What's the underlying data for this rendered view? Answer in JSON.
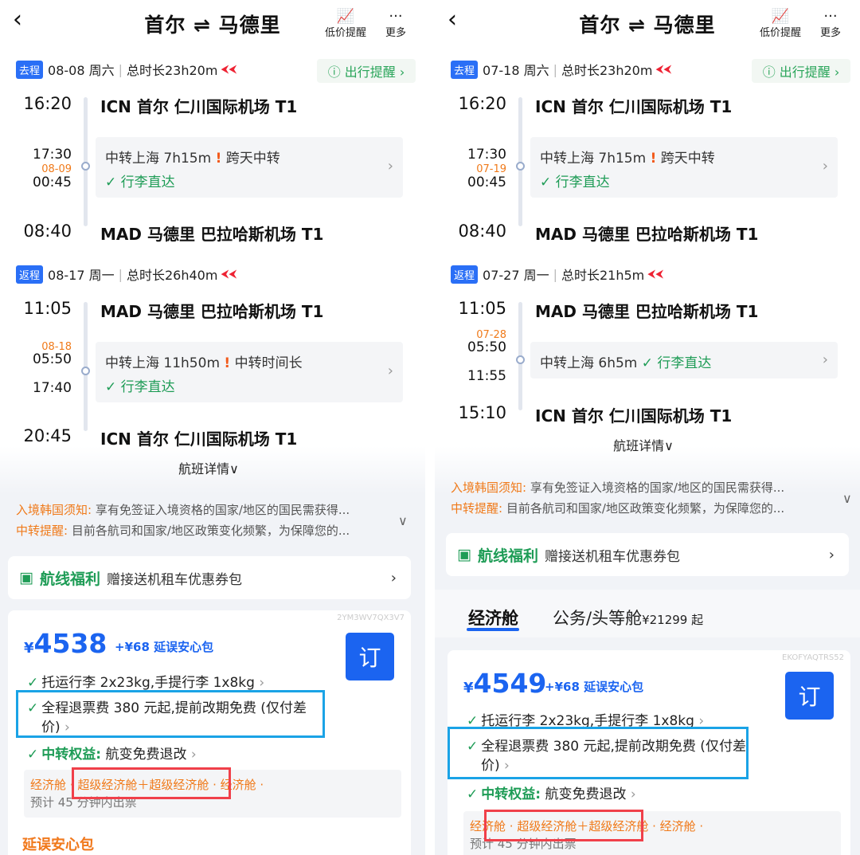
{
  "left": {
    "header": {
      "title": "首尔 ⇌ 马德里",
      "lowprice_label": "低价提醒",
      "more_label": "更多"
    },
    "outbound": {
      "tag": "去程",
      "date": "08-08 周六",
      "duration": "总时长23h20m",
      "remind": "ⓘ 出行提醒 ›",
      "dep_time": "16:20",
      "dep_airport": "ICN 首尔 仁川国际机场 T1",
      "t_arr": "17:30",
      "t_nextday": "08-09",
      "t_dep": "00:45",
      "transfer": "中转上海 7h15m",
      "warn_icon": "!",
      "warn_text": "跨天中转",
      "baggage": "✓ 行李直达",
      "arr_time": "08:40",
      "arr_airport": "MAD 马德里 巴拉哈斯机场 T1"
    },
    "return": {
      "tag": "返程",
      "date": "08-17 周一",
      "duration": "总时长26h40m",
      "dep_time": "11:05",
      "dep_airport": "MAD 马德里 巴拉哈斯机场 T1",
      "t_nextday": "08-18",
      "t_arr": "05:50",
      "t_dep": "17:40",
      "transfer": "中转上海 11h50m",
      "warn_icon": "!",
      "warn_text": "中转时间长",
      "baggage": "✓ 行李直达",
      "arr_time": "20:45",
      "arr_airport": "ICN 首尔 仁川国际机场 T1"
    },
    "detail": "航班详情∨",
    "notice1_label": "入境韩国须知:",
    "notice1_text": "享有免签证入境资格的国家/地区的国民需获得...",
    "notice2_label": "中转提醒:",
    "notice2_text": "目前各航司和国家/地区政策变化频繁，为保障您的...",
    "benefit_title": "航线福利",
    "benefit_text": "赠接送机租车优惠券包",
    "card": {
      "code": "2YM3WV7QX3V7",
      "currency": "¥",
      "price": "4538",
      "addon": "+¥68 延误安心包",
      "book": "订",
      "row1": "托运行李 2x23kg,手提行李 1x8kg",
      "row2a": "全程退票费 380 元起,提前改期免费 (仅付差",
      "row2b": "价)",
      "row3_label": "中转权益:",
      "row3_text": "航变免费退改",
      "cabin1": "经济舱 · ",
      "cabin2": "超级经济舱＋超级经济舱",
      "cabin3": " · 经济舱 ·",
      "cabin_note": "预计 45 分钟内出票",
      "promo": "延误安心包"
    }
  },
  "right": {
    "header": {
      "title": "首尔 ⇌ 马德里",
      "lowprice_label": "低价提醒",
      "more_label": "更多"
    },
    "outbound": {
      "tag": "去程",
      "date": "07-18 周六",
      "duration": "总时长23h20m",
      "remind": "ⓘ 出行提醒 ›",
      "dep_time": "16:20",
      "dep_airport": "ICN 首尔 仁川国际机场 T1",
      "t_arr": "17:30",
      "t_nextday": "07-19",
      "t_dep": "00:45",
      "transfer": "中转上海 7h15m",
      "warn_icon": "!",
      "warn_text": "跨天中转",
      "baggage": "✓ 行李直达",
      "arr_time": "08:40",
      "arr_airport": "MAD 马德里 巴拉哈斯机场 T1"
    },
    "return": {
      "tag": "返程",
      "date": "07-27 周一",
      "duration": "总时长21h5m",
      "dep_time": "11:05",
      "dep_airport": "MAD 马德里 巴拉哈斯机场 T1",
      "t_nextday": "07-28",
      "t_arr": "05:50",
      "t_dep": "11:55",
      "transfer": "中转上海 6h5m",
      "baggage": "✓ 行李直达",
      "arr_time": "15:10",
      "arr_airport": "ICN 首尔 仁川国际机场 T1"
    },
    "detail": "航班详情∨",
    "notice1_label": "入境韩国须知:",
    "notice1_text": "享有免签证入境资格的国家/地区的国民需获得...",
    "notice2_label": "中转提醒:",
    "notice2_text": "目前各航司和国家/地区政策变化频繁，为保障您的...",
    "benefit_title": "航线福利",
    "benefit_text": "赠接送机租车优惠券包",
    "tab_economy": "经济舱",
    "tab_business": "公务/头等舱",
    "tab_business_price": "¥21299 起",
    "card": {
      "code": "EKOFYAQTRS52",
      "currency": "¥",
      "price": "4549",
      "addon": "+¥68 延误安心包",
      "book": "订",
      "row1": "托运行李 2x23kg,手提行李 1x8kg",
      "row2a": "全程退票费 380 元起,提前改期免费 (仅付差",
      "row2b": "价)",
      "row3_label": "中转权益:",
      "row3_text": "航变免费退改",
      "cabin1": "经济舱 · ",
      "cabin2": "超级经济舱＋超级经济舱",
      "cabin3": " · 经济舱 ·",
      "cabin_note": "预计 45 分钟内出票"
    }
  },
  "colors": {
    "accent": "#1b64f0",
    "green": "#1e9c56",
    "orange": "#f07a1a",
    "highlight_blue": "#1aa3e6",
    "highlight_red": "#f0404a"
  }
}
